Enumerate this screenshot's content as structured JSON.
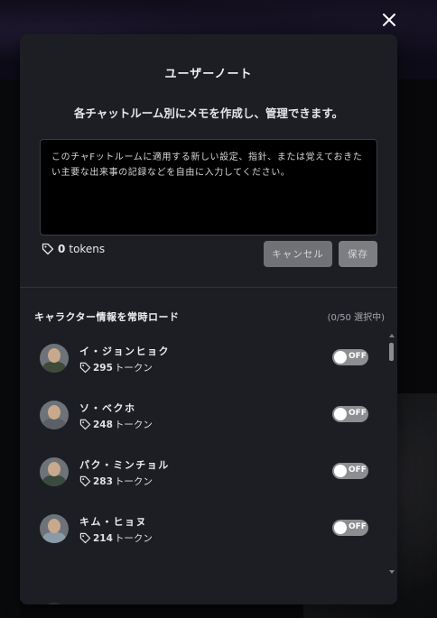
{
  "dialog": {
    "title": "ユーザーノート",
    "description": "各チャットルーム別にメモを作成し、管理できます。",
    "memo_placeholder": "このチャFットルームに適用する新しい設定、指針、または覚えておきたい主要な出来事の記録などを自由に入力してください。",
    "memo_value": "",
    "token_count": "0",
    "token_label": "tokens",
    "cancel_label": "キャンセル",
    "save_label": "保存"
  },
  "characters_section": {
    "title": "キャラクター情報を常時ロード",
    "count_text": "(0/50 選択中)",
    "items": [
      {
        "name": "イ・ジョンヒョク",
        "tokens": "295",
        "token_unit": "トークン",
        "toggle": "OFF",
        "avatar_color": "#3f4a3a"
      },
      {
        "name": "ソ・ベクホ",
        "tokens": "248",
        "token_unit": "トークン",
        "toggle": "OFF",
        "avatar_color": "#5b6066"
      },
      {
        "name": "パク・ミンチョル",
        "tokens": "283",
        "token_unit": "トークン",
        "toggle": "OFF",
        "avatar_color": "#3a4a3c"
      },
      {
        "name": "キム・ヒョヌ",
        "tokens": "214",
        "token_unit": "トークン",
        "toggle": "OFF",
        "avatar_color": "#8a9aa8"
      }
    ]
  },
  "icons": {
    "close": "close-icon",
    "tag": "tag-icon"
  },
  "colors": {
    "modal_bg": "#1c1e24",
    "memo_bg": "#000000",
    "toggle_off": "#8c8e92",
    "button_cancel": "#707276",
    "button_save": "#7c7e82"
  }
}
